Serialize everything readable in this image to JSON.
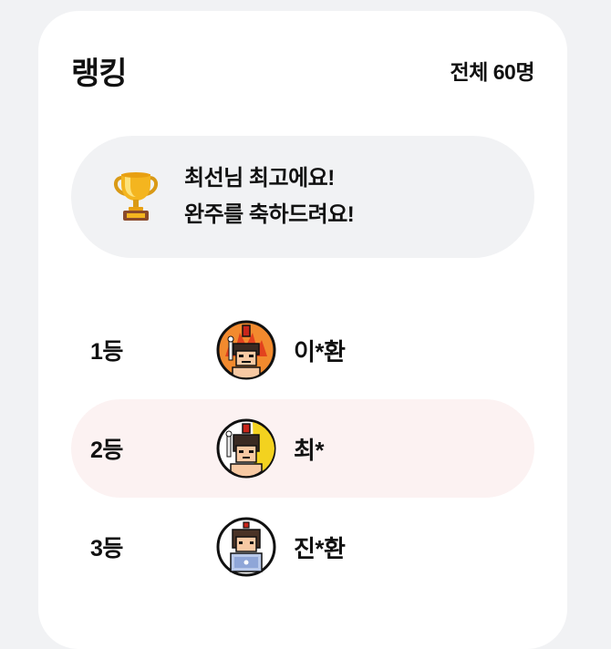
{
  "header": {
    "title": "랭킹",
    "total": "전체 60명"
  },
  "banner": {
    "icon": "trophy-icon",
    "line1": "최선님 최고에요!",
    "line2": "완주를 축하드려요!"
  },
  "ranking": [
    {
      "rank": "1등",
      "name": "이*환",
      "avatar": "gladiator-avatar-fire",
      "highlight": false
    },
    {
      "rank": "2등",
      "name": "최*",
      "avatar": "gladiator-avatar-gold",
      "highlight": true
    },
    {
      "rank": "3등",
      "name": "진*환",
      "avatar": "laptop-avatar",
      "highlight": false
    }
  ],
  "colors": {
    "background": "#f1f2f4",
    "card": "#ffffff",
    "banner": "#f1f2f4",
    "highlight_row": "#fcf2f2",
    "avatar_fire": "#f28a2e",
    "avatar_gold": "#f3d21f"
  }
}
